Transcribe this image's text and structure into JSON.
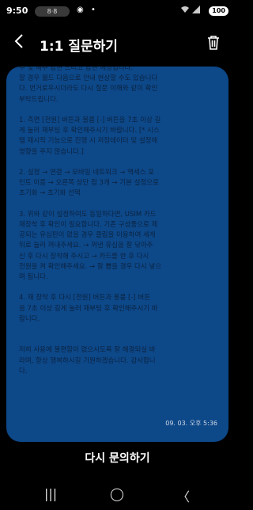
{
  "status_bar": {
    "time": "9:50",
    "notification_pill": "8·8",
    "battery": "100"
  },
  "header": {
    "title": "1:1 질문하기"
  },
  "message": {
    "lines": [
      "주 및 해주 답변 드리고 답변 에정입니다.",
      "할 경우 웰드 다음으로 안내 현상할 수도 있습니다",
      "다. 번거로우시더라도 다시 질문 이해와 같이 확인",
      "부탁드립니다.",
      "",
      "1. 측면 [전원] 버튼과 볼륨 [-] 버튼을 7초 이상 길",
      "게 눌러 재부팅 후 확인해주시기 바랍니다. [* 시스",
      "템 재시작 기능으로 진행 시 저장데이터 및 설정에",
      "영향을 주지 않습니다.]",
      "",
      "2. 설정 → 연결 → 모바일 네트워크 → 액세스 포",
      "인트 이름 → 오른쪽 상단 점 3개 → 기본 설정으로",
      "초기화 → 초기화 선택",
      "",
      "3. 위와 같이 설정하여도 동일하다면, USIM 카드",
      "재장착 후 확인이 필요합니다. 기존 구성품으로 제",
      "공되는 유심핀이 없을 경우 클립을 이용하여 세게",
      "뒤로 눌러 꺼내주세요. → 꺼낸 유심을 잘 닦아주",
      "신 후 다시 장착해 주시고 → 카드를 한 후 다시",
      "전원을 켜 확인해주세요. → 잘 뽑을 경우 다시 넣으",
      "며 됩니다.",
      "",
      "4. 재 장착 후 다시 [전원] 버튼과 볼륨 [-] 버튼",
      "을 7초 이상 길게 눌러 재부팅 후 확인해주시기 바",
      "랍니다.",
      "",
      "",
      "저희 사용에 불편함이 없으시도록 잘 해결되실 바",
      "라며, 항상 행복하시길 기원하겠습니다. 감사합니",
      "다."
    ],
    "timestamp": "09. 03. 오후 5:36"
  },
  "footer": {
    "retry_label": "다시 문의하기"
  },
  "nav": {
    "recents": "|||",
    "home": "◯",
    "back": "〈"
  }
}
